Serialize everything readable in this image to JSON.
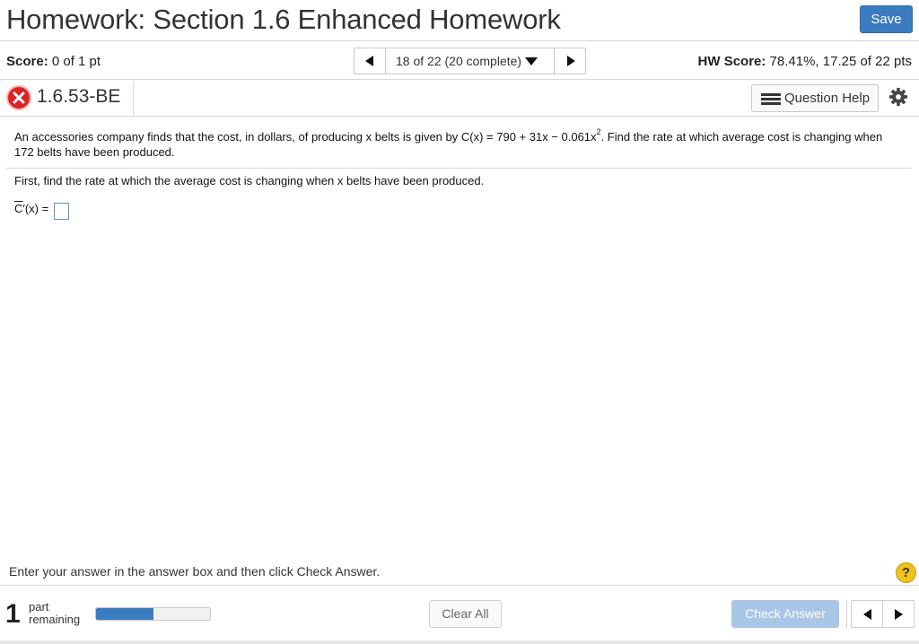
{
  "header": {
    "title": "Homework: Section 1.6 Enhanced Homework",
    "save_label": "Save"
  },
  "score_bar": {
    "score_label": "Score:",
    "score_value": "0 of 1 pt",
    "counter": "18 of 22 (20 complete)",
    "hw_score_label": "HW Score:",
    "hw_score_value": "78.41%, 17.25 of 22 pts"
  },
  "question_bar": {
    "question_id": "1.6.53-BE",
    "status_icon": "x-icon",
    "help_label": "Question Help",
    "settings_icon": "gear-icon"
  },
  "problem": {
    "text_before_exp": "An accessories company finds that the cost, in dollars, of producing x belts is given by C(x) = 790 + 31x − 0.061x",
    "exponent": "2",
    "text_after_exp": ". Find the rate at which average cost is changing when 172 belts have been produced.",
    "first_step": "First, find the rate at which the average cost is changing when x belts have been produced.",
    "answer_label_c": "C",
    "answer_label_rest": "′(x) ="
  },
  "footer": {
    "instruction": "Enter your answer in the answer box and then click Check Answer.",
    "parts_count": "1",
    "parts_label_line1": "part",
    "parts_label_line2": "remaining",
    "progress_fraction": 0.5,
    "clear_label": "Clear All",
    "check_label": "Check Answer",
    "help_glyph": "?"
  },
  "colors": {
    "accent": "#3b7bbf",
    "check_disabled": "#a9c6e6",
    "error_red": "#dd2222",
    "help_yellow": "#f2c21c"
  }
}
